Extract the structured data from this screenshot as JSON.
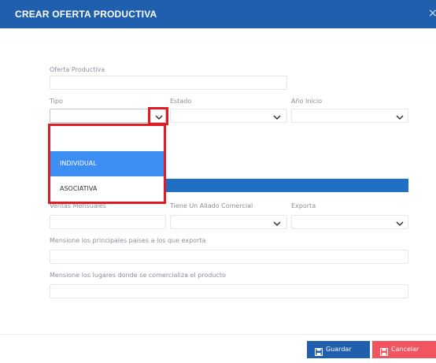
{
  "header": {
    "title": "CREAR OFERTA PRODUCTIVA",
    "close_icon": "close-icon"
  },
  "form": {
    "oferta_productiva": {
      "label": "Oferta Productiva",
      "value": ""
    },
    "tipo": {
      "label": "Tipo",
      "value": ""
    },
    "estado": {
      "label": "Estado",
      "value": ""
    },
    "ano_inicio": {
      "label": "Año Inicio",
      "value": ""
    },
    "ventas_mensuales": {
      "label": "Ventas Mensuales",
      "value": ""
    },
    "aliado_comercial": {
      "label": "Tiene Un Aliado Comercial",
      "value": ""
    },
    "exporta": {
      "label": "Exporta",
      "value": ""
    },
    "paises_exporta": {
      "label": "Mensione los principales paises a los que exporta",
      "value": ""
    },
    "lugares_comercializa": {
      "label": "Mensione los lugares donde se comercializa el producto",
      "value": ""
    }
  },
  "tipo_dropdown": {
    "options": [
      {
        "label": "",
        "selected": false
      },
      {
        "label": "INDIVIDUAL",
        "selected": true
      },
      {
        "label": "ASOCIATIVA",
        "selected": false
      }
    ]
  },
  "footer": {
    "save_label": "Guardar",
    "cancel_label": "Cancelar"
  },
  "colors": {
    "header": "#1f5fae",
    "selected_option": "#3d8ef2",
    "highlight": "#e01b24",
    "save": "#1f5fae",
    "cancel": "#f05560"
  }
}
